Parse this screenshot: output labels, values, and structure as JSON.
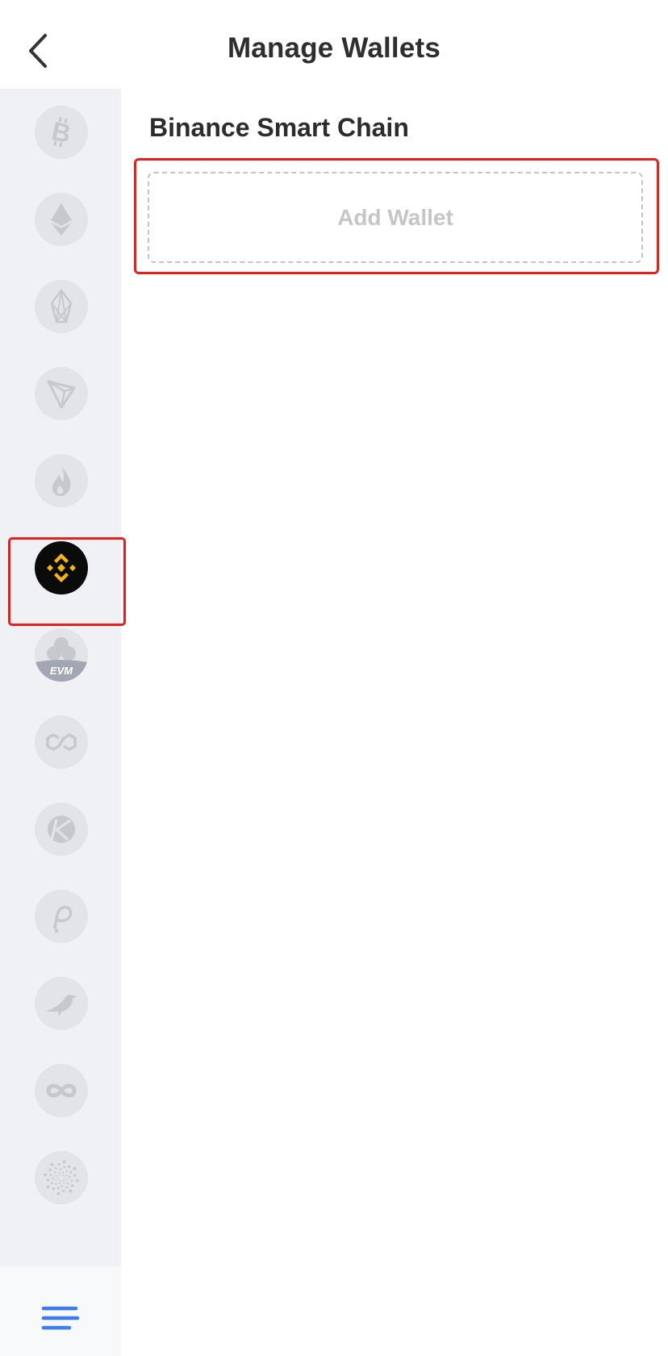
{
  "header": {
    "title": "Manage Wallets"
  },
  "main": {
    "section_title": "Binance Smart Chain",
    "add_wallet_label": "Add Wallet"
  },
  "sidebar": {
    "items": [
      {
        "name": "bitcoin-icon",
        "selected": false
      },
      {
        "name": "ethereum-icon",
        "selected": false
      },
      {
        "name": "eos-icon",
        "selected": false
      },
      {
        "name": "tron-icon",
        "selected": false
      },
      {
        "name": "heco-flame-icon",
        "selected": false
      },
      {
        "name": "binance-icon",
        "selected": true
      },
      {
        "name": "evm-clover-icon",
        "selected": false,
        "label": "EVM"
      },
      {
        "name": "polygon-icon",
        "selected": false
      },
      {
        "name": "kusama-k-icon",
        "selected": false
      },
      {
        "name": "polkadot-icon",
        "selected": false
      },
      {
        "name": "bird-icon",
        "selected": false
      },
      {
        "name": "infinity-loop-icon",
        "selected": false
      },
      {
        "name": "iota-spiral-icon",
        "selected": false
      }
    ]
  },
  "colors": {
    "accent_blue": "#3d7bf0",
    "binance_gold": "#f0b90b",
    "highlight_red": "#e8201c",
    "icon_gray": "#c7c8cd",
    "sidebar_bg": "#eff1f5"
  }
}
